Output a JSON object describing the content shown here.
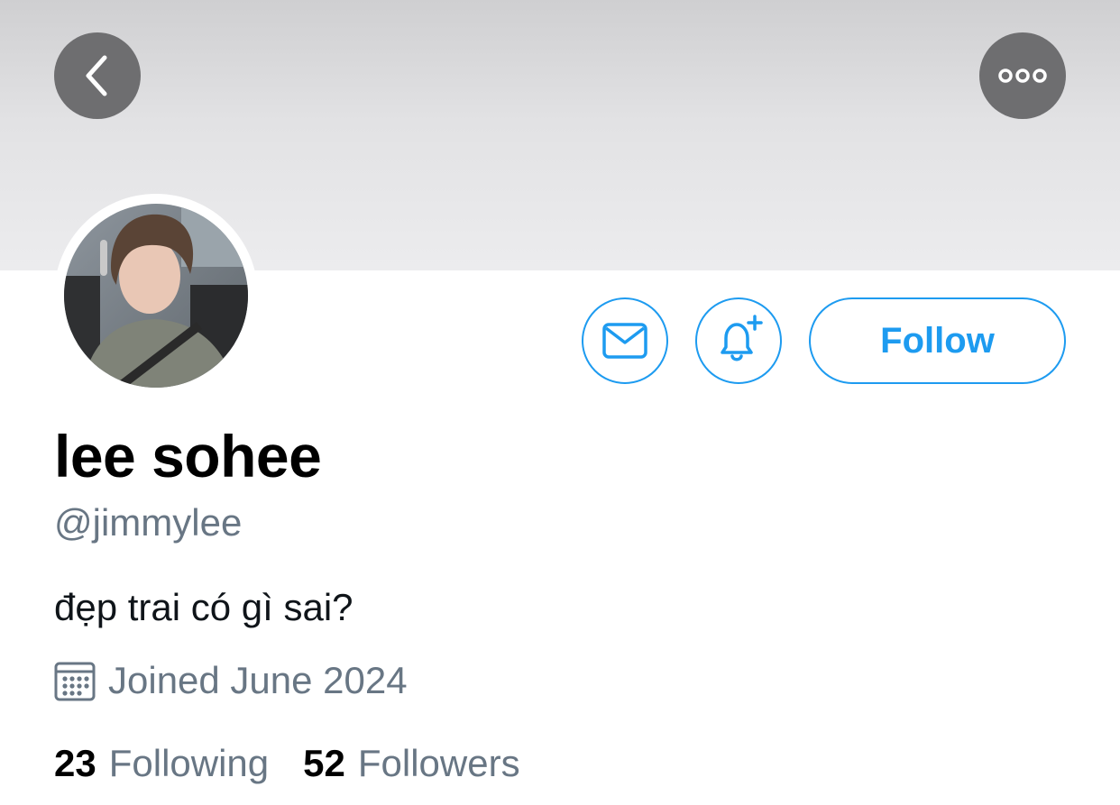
{
  "profile": {
    "display_name": "lee sohee",
    "handle": "@jimmylee",
    "bio": "đẹp trai có gì sai?",
    "joined": "Joined June 2024"
  },
  "actions": {
    "follow_label": "Follow"
  },
  "stats": {
    "following_count": "23",
    "following_label": "Following",
    "followers_count": "52",
    "followers_label": "Followers"
  },
  "icons": {
    "back": "chevron-left-icon",
    "more": "more-horizontal-icon",
    "message": "envelope-icon",
    "notify": "bell-plus-icon",
    "calendar": "calendar-icon"
  },
  "colors": {
    "accent": "#1d9bf0",
    "secondary_text": "#687684",
    "primary_text": "#0f1419",
    "overlay_button": "#6e6e70",
    "banner": "#e2e2e4"
  }
}
